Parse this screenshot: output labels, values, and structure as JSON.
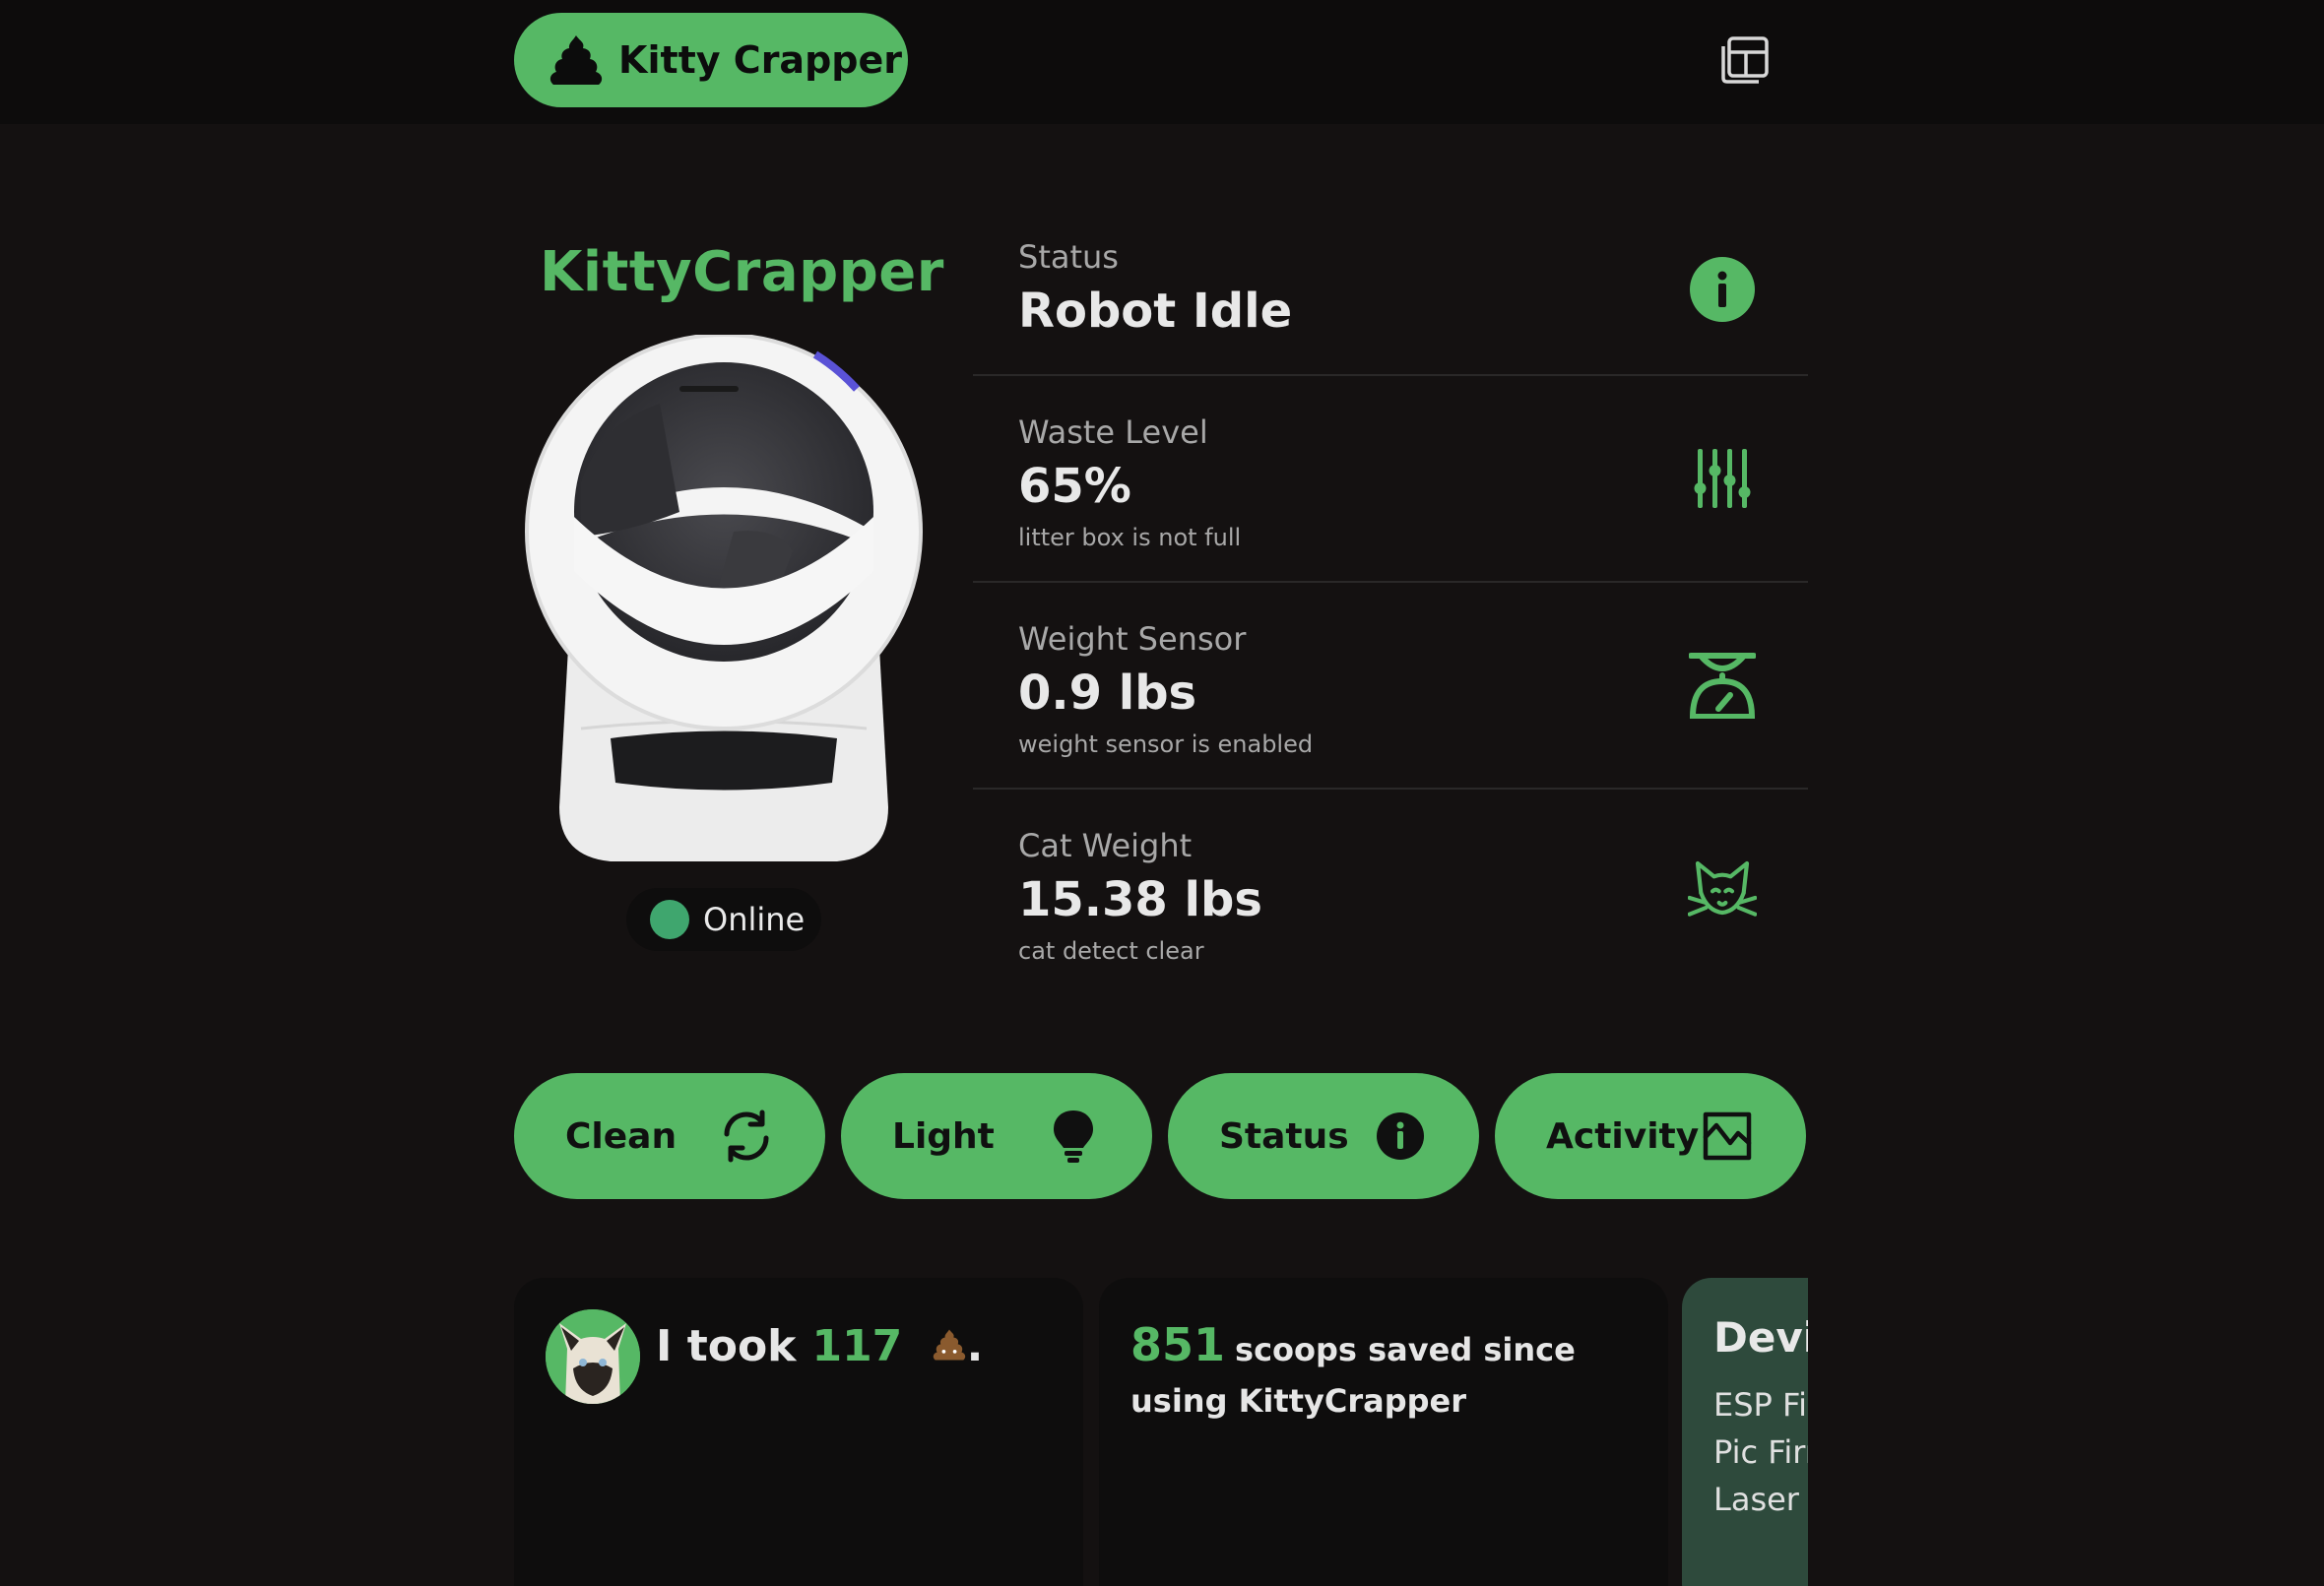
{
  "header": {
    "brand_label": "Kitty Crapper",
    "brand_icon": "poop-icon",
    "layout_icon": "layout-icon"
  },
  "device": {
    "name": "KittyCrapper",
    "connection": "Online"
  },
  "stats": [
    {
      "label": "Status",
      "value": "Robot Idle",
      "sub": "",
      "icon": "info-icon"
    },
    {
      "label": "Waste Level",
      "value": "65%",
      "sub": "litter box is not full",
      "icon": "sliders-icon"
    },
    {
      "label": "Weight Sensor",
      "value": "0.9 lbs",
      "sub": "weight sensor is enabled",
      "icon": "scale-icon"
    },
    {
      "label": "Cat Weight",
      "value": "15.38 lbs",
      "sub": "cat detect clear",
      "icon": "cat-icon"
    }
  ],
  "actions": [
    {
      "label": "Clean",
      "icon": "refresh-icon"
    },
    {
      "label": "Light",
      "icon": "lightbulb-icon"
    },
    {
      "label": "Status",
      "icon": "info-icon"
    },
    {
      "label": "Activity",
      "icon": "chart-icon"
    }
  ],
  "cards": {
    "took": {
      "prefix": "I took",
      "count": "117",
      "suffix": "."
    },
    "scoops": {
      "count": "851",
      "text": "scoops saved since using KittyCrapper"
    },
    "device_info": {
      "title": "Devic",
      "lines": [
        "ESP Fir",
        "Pic Firm",
        "Laser E"
      ]
    }
  },
  "colors": {
    "accent": "#56b865",
    "background": "#141111",
    "topbar": "#0d0c0c",
    "online_dot": "#3fa66e"
  }
}
